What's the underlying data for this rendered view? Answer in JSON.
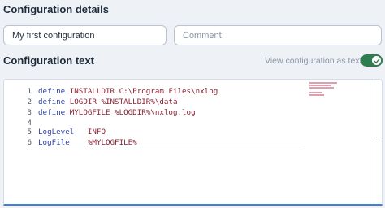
{
  "details": {
    "title": "Configuration details",
    "name_value": "My first configuration",
    "comment_placeholder": "Comment"
  },
  "config_text": {
    "title": "Configuration text",
    "toggle_label": "View configuration as text",
    "toggle_on": true
  },
  "editor": {
    "lines": [
      {
        "num": "1",
        "keyword": "define",
        "rest": " INSTALLDIR C:\\Program Files\\nxlog"
      },
      {
        "num": "2",
        "keyword": "define",
        "rest": " LOGDIR %INSTALLDIR%\\data"
      },
      {
        "num": "3",
        "keyword": "define",
        "rest": " MYLOGFILE %LOGDIR%\\nxlog.log"
      },
      {
        "num": "4",
        "keyword": "",
        "rest": ""
      },
      {
        "num": "5",
        "keyword": "LogLevel",
        "rest": "   INFO"
      },
      {
        "num": "6",
        "keyword": "LogFile",
        "rest": "    %MYLOGFILE%"
      }
    ]
  },
  "colors": {
    "toggle_on": "#2e7d4f",
    "keyword": "#2c3fa8",
    "value": "#8b2231",
    "focus_border": "#3f7fe0"
  }
}
